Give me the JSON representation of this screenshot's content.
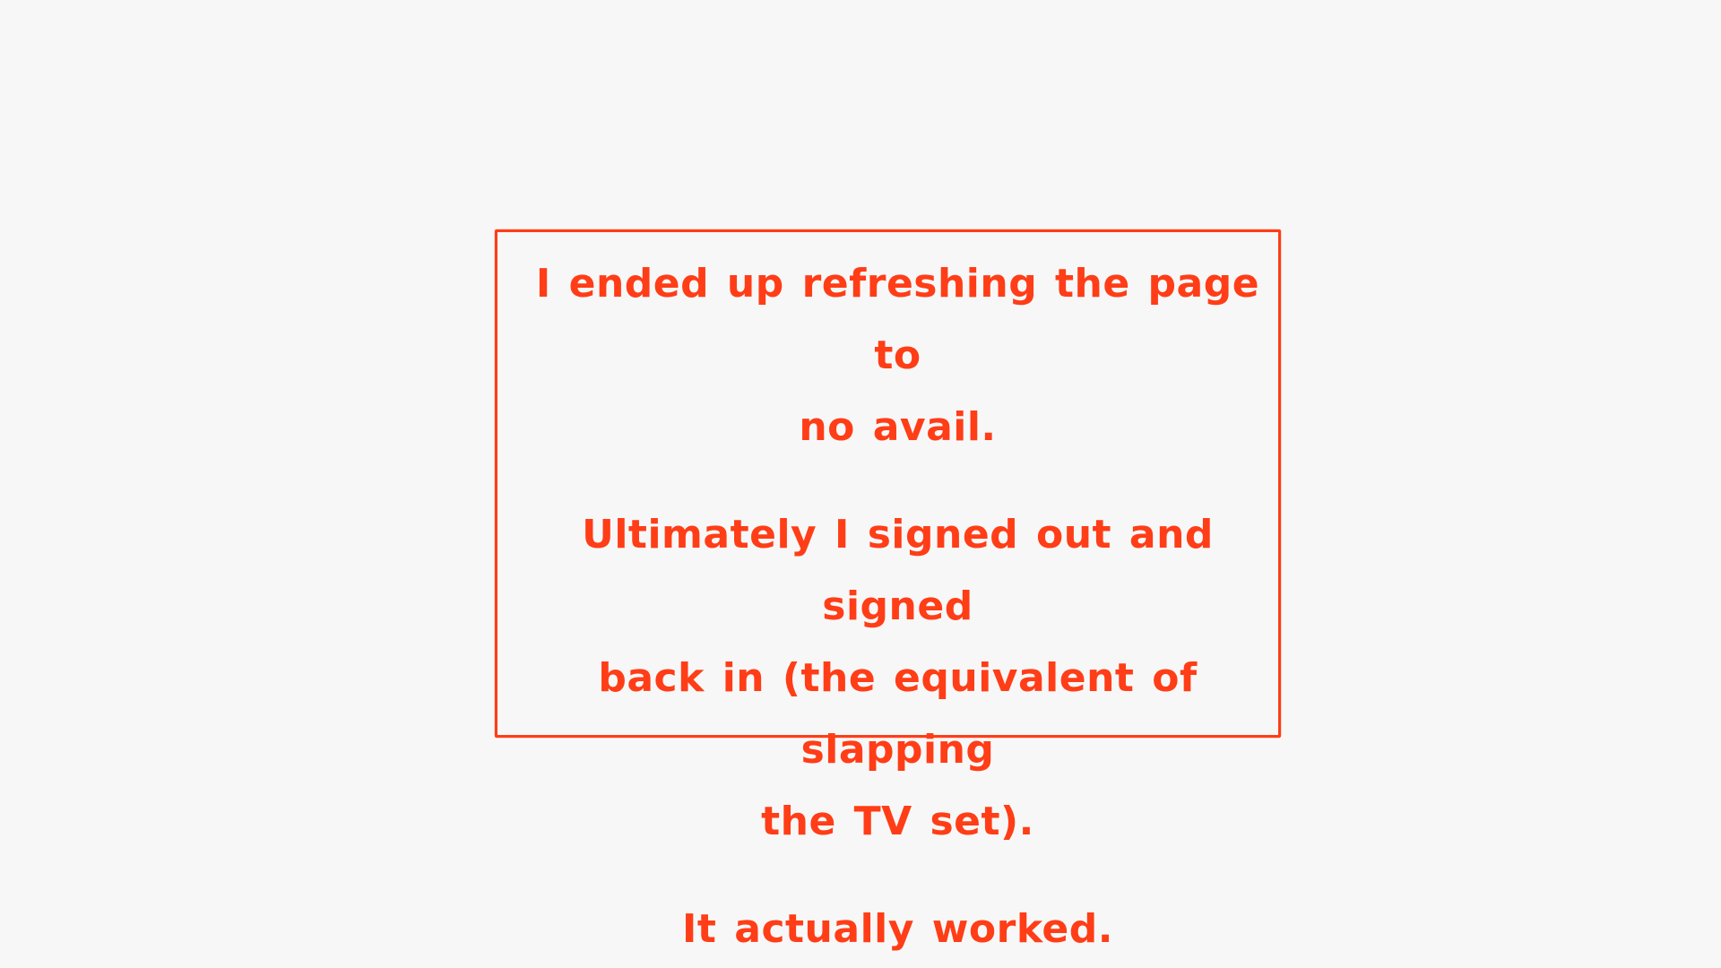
{
  "note": {
    "border_color": "#ff3d17",
    "text_color": "#ff3d17",
    "background_color": "#f7f7f7",
    "paragraphs": [
      "I ended up refreshing the page to\nno avail.",
      "Ultimately I signed out and signed\nback in (the equivalent of slapping\nthe TV set).",
      "It actually worked."
    ]
  }
}
